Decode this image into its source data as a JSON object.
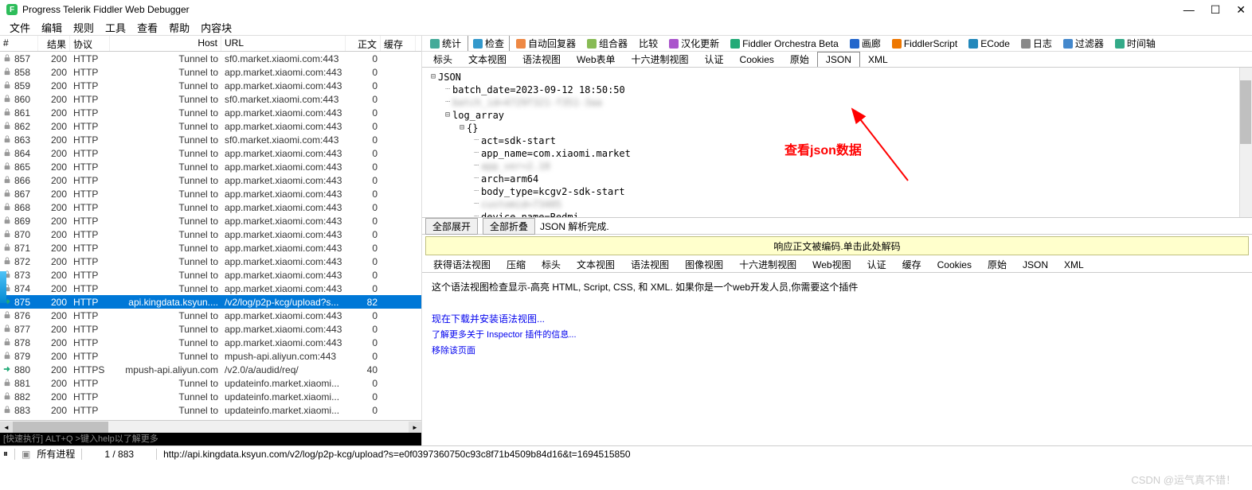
{
  "window": {
    "title": "Progress Telerik Fiddler Web Debugger"
  },
  "menubar": [
    "文件",
    "编辑",
    "规则",
    "工具",
    "查看",
    "帮助",
    "内容块"
  ],
  "sessions": {
    "headers": {
      "id": "#",
      "result": "结果",
      "protocol": "协议",
      "host": "Host",
      "url": "URL",
      "body": "正文",
      "cache": "缓存"
    },
    "rows": [
      {
        "id": "857",
        "result": "200",
        "protocol": "HTTP",
        "host": "Tunnel to",
        "url": "sf0.market.xiaomi.com:443",
        "body": "0",
        "cache": "",
        "icon": "lock"
      },
      {
        "id": "858",
        "result": "200",
        "protocol": "HTTP",
        "host": "Tunnel to",
        "url": "app.market.xiaomi.com:443",
        "body": "0",
        "cache": "",
        "icon": "lock"
      },
      {
        "id": "859",
        "result": "200",
        "protocol": "HTTP",
        "host": "Tunnel to",
        "url": "app.market.xiaomi.com:443",
        "body": "0",
        "cache": "",
        "icon": "lock"
      },
      {
        "id": "860",
        "result": "200",
        "protocol": "HTTP",
        "host": "Tunnel to",
        "url": "sf0.market.xiaomi.com:443",
        "body": "0",
        "cache": "",
        "icon": "lock"
      },
      {
        "id": "861",
        "result": "200",
        "protocol": "HTTP",
        "host": "Tunnel to",
        "url": "app.market.xiaomi.com:443",
        "body": "0",
        "cache": "",
        "icon": "lock"
      },
      {
        "id": "862",
        "result": "200",
        "protocol": "HTTP",
        "host": "Tunnel to",
        "url": "app.market.xiaomi.com:443",
        "body": "0",
        "cache": "",
        "icon": "lock"
      },
      {
        "id": "863",
        "result": "200",
        "protocol": "HTTP",
        "host": "Tunnel to",
        "url": "sf0.market.xiaomi.com:443",
        "body": "0",
        "cache": "",
        "icon": "lock"
      },
      {
        "id": "864",
        "result": "200",
        "protocol": "HTTP",
        "host": "Tunnel to",
        "url": "app.market.xiaomi.com:443",
        "body": "0",
        "cache": "",
        "icon": "lock"
      },
      {
        "id": "865",
        "result": "200",
        "protocol": "HTTP",
        "host": "Tunnel to",
        "url": "app.market.xiaomi.com:443",
        "body": "0",
        "cache": "",
        "icon": "lock"
      },
      {
        "id": "866",
        "result": "200",
        "protocol": "HTTP",
        "host": "Tunnel to",
        "url": "app.market.xiaomi.com:443",
        "body": "0",
        "cache": "",
        "icon": "lock"
      },
      {
        "id": "867",
        "result": "200",
        "protocol": "HTTP",
        "host": "Tunnel to",
        "url": "app.market.xiaomi.com:443",
        "body": "0",
        "cache": "",
        "icon": "lock"
      },
      {
        "id": "868",
        "result": "200",
        "protocol": "HTTP",
        "host": "Tunnel to",
        "url": "app.market.xiaomi.com:443",
        "body": "0",
        "cache": "",
        "icon": "lock"
      },
      {
        "id": "869",
        "result": "200",
        "protocol": "HTTP",
        "host": "Tunnel to",
        "url": "app.market.xiaomi.com:443",
        "body": "0",
        "cache": "",
        "icon": "lock"
      },
      {
        "id": "870",
        "result": "200",
        "protocol": "HTTP",
        "host": "Tunnel to",
        "url": "app.market.xiaomi.com:443",
        "body": "0",
        "cache": "",
        "icon": "lock"
      },
      {
        "id": "871",
        "result": "200",
        "protocol": "HTTP",
        "host": "Tunnel to",
        "url": "app.market.xiaomi.com:443",
        "body": "0",
        "cache": "",
        "icon": "lock"
      },
      {
        "id": "872",
        "result": "200",
        "protocol": "HTTP",
        "host": "Tunnel to",
        "url": "app.market.xiaomi.com:443",
        "body": "0",
        "cache": "",
        "icon": "lock"
      },
      {
        "id": "873",
        "result": "200",
        "protocol": "HTTP",
        "host": "Tunnel to",
        "url": "app.market.xiaomi.com:443",
        "body": "0",
        "cache": "",
        "icon": "lock"
      },
      {
        "id": "874",
        "result": "200",
        "protocol": "HTTP",
        "host": "Tunnel to",
        "url": "app.market.xiaomi.com:443",
        "body": "0",
        "cache": "",
        "icon": "lock"
      },
      {
        "id": "875",
        "result": "200",
        "protocol": "HTTP",
        "host": "api.kingdata.ksyun....",
        "url": "/v2/log/p2p-kcg/upload?s...",
        "body": "82",
        "cache": "",
        "icon": "arrow",
        "selected": true
      },
      {
        "id": "876",
        "result": "200",
        "protocol": "HTTP",
        "host": "Tunnel to",
        "url": "app.market.xiaomi.com:443",
        "body": "0",
        "cache": "",
        "icon": "lock"
      },
      {
        "id": "877",
        "result": "200",
        "protocol": "HTTP",
        "host": "Tunnel to",
        "url": "app.market.xiaomi.com:443",
        "body": "0",
        "cache": "",
        "icon": "lock"
      },
      {
        "id": "878",
        "result": "200",
        "protocol": "HTTP",
        "host": "Tunnel to",
        "url": "app.market.xiaomi.com:443",
        "body": "0",
        "cache": "",
        "icon": "lock"
      },
      {
        "id": "879",
        "result": "200",
        "protocol": "HTTP",
        "host": "Tunnel to",
        "url": "mpush-api.aliyun.com:443",
        "body": "0",
        "cache": "",
        "icon": "lock"
      },
      {
        "id": "880",
        "result": "200",
        "protocol": "HTTPS",
        "host": "mpush-api.aliyun.com",
        "url": "/v2.0/a/audid/req/",
        "body": "40",
        "cache": "",
        "icon": "arrow"
      },
      {
        "id": "881",
        "result": "200",
        "protocol": "HTTP",
        "host": "Tunnel to",
        "url": "updateinfo.market.xiaomi...",
        "body": "0",
        "cache": "",
        "icon": "lock"
      },
      {
        "id": "882",
        "result": "200",
        "protocol": "HTTP",
        "host": "Tunnel to",
        "url": "updateinfo.market.xiaomi...",
        "body": "0",
        "cache": "",
        "icon": "lock"
      },
      {
        "id": "883",
        "result": "200",
        "protocol": "HTTP",
        "host": "Tunnel to",
        "url": "updateinfo.market.xiaomi...",
        "body": "0",
        "cache": "",
        "icon": "lock"
      }
    ]
  },
  "topTabs": [
    {
      "label": "统计",
      "icon": "stats"
    },
    {
      "label": "检查",
      "icon": "inspect",
      "active": true
    },
    {
      "label": "自动回复器",
      "icon": "reply"
    },
    {
      "label": "组合器",
      "icon": "composer"
    },
    {
      "label": "比较"
    },
    {
      "label": "汉化更新",
      "icon": "update"
    },
    {
      "label": "Fiddler Orchestra Beta",
      "icon": "fo"
    },
    {
      "label": "画廊",
      "icon": "gallery"
    },
    {
      "label": "FiddlerScript",
      "icon": "fs"
    },
    {
      "label": "ECode",
      "icon": "ecode"
    },
    {
      "label": "日志",
      "icon": "log"
    },
    {
      "label": "过滤器",
      "icon": "filter"
    },
    {
      "label": "时间轴",
      "icon": "timeline"
    }
  ],
  "reqTabs": [
    "标头",
    "文本视图",
    "语法视图",
    "Web表单",
    "十六进制视图",
    "认证",
    "Cookies",
    "原始",
    "JSON",
    "XML"
  ],
  "reqActiveTab": "JSON",
  "jsonTree": [
    {
      "indent": 0,
      "toggle": "-",
      "text": "JSON"
    },
    {
      "indent": 1,
      "toggle": "",
      "text": "batch_date=2023-09-12 18:50:50"
    },
    {
      "indent": 1,
      "toggle": "",
      "text": "batch_id=4729f321-f351-3aa",
      "blur": true
    },
    {
      "indent": 1,
      "toggle": "-",
      "text": "log_array"
    },
    {
      "indent": 2,
      "toggle": "-",
      "text": "{}"
    },
    {
      "indent": 3,
      "toggle": "",
      "text": "act=sdk-start"
    },
    {
      "indent": 3,
      "toggle": "",
      "text": "app_name=com.xiaomi.market"
    },
    {
      "indent": 3,
      "toggle": "",
      "text": "app_ver=2.10",
      "blur": true
    },
    {
      "indent": 3,
      "toggle": "",
      "text": "arch=arm64"
    },
    {
      "indent": 3,
      "toggle": "",
      "text": "body_type=kcgv2-sdk-start"
    },
    {
      "indent": 3,
      "toggle": "",
      "text": "customid=73405",
      "blur": true
    },
    {
      "indent": 3,
      "toggle": "",
      "text": "device_name=Redmi"
    }
  ],
  "jsonToolbar": {
    "expandAll": "全部展开",
    "collapseAll": "全部折叠",
    "status": "JSON 解析完成."
  },
  "decodeBar": "响应正文被编码.单击此处解码",
  "respTabs": [
    "获得语法视图",
    "压缩",
    "标头",
    "文本视图",
    "语法视图",
    "图像视图",
    "十六进制视图",
    "Web视图",
    "认证",
    "缓存",
    "Cookies",
    "原始",
    "JSON",
    "XML"
  ],
  "respContent": {
    "line1": "这个语法视图检查显示-高亮 HTML, Script, CSS, 和 XML. 如果你是一个web开发人员,你需要这个插件",
    "link1": "现在下载并安装语法视图...",
    "link2": "了解更多关于 Inspector 插件的信息...",
    "link3": "移除该页面"
  },
  "annotation": "查看json数据",
  "quickexec": "[快速执行] ALT+Q >键入help以了解更多",
  "statusbar": {
    "processes": "所有进程",
    "count": "1 / 883",
    "url": "http://api.kingdata.ksyun.com/v2/log/p2p-kcg/upload?s=e0f0397360750c93c8f71b4509b84d16&t=1694515850"
  },
  "watermark": "CSDN @运气真不错！"
}
